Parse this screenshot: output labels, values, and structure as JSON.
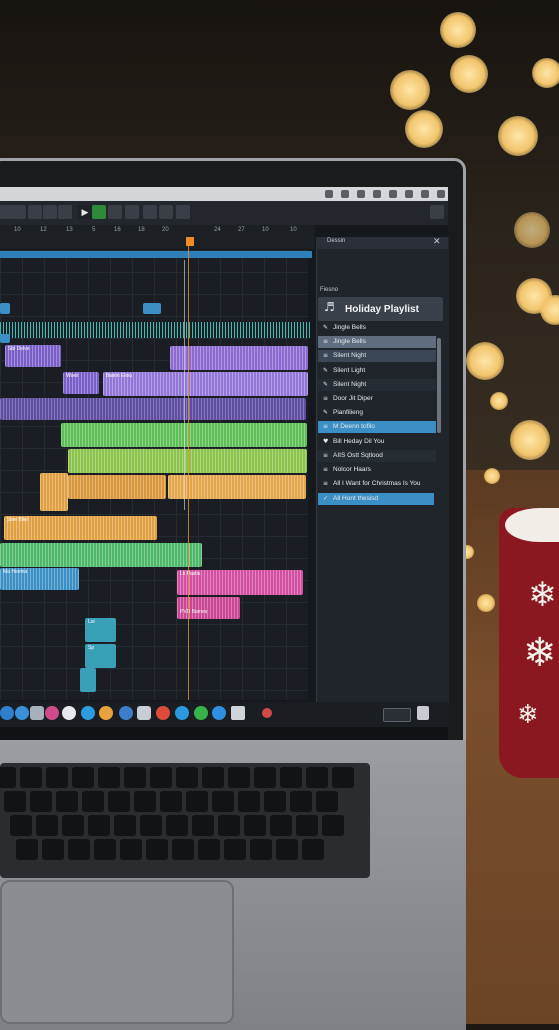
{
  "toolbar": {
    "play_icon": "▶"
  },
  "ruler": {
    "ticks": [
      "10",
      "12",
      "13",
      "5",
      "16",
      "18",
      "20",
      "24",
      "27",
      "10",
      "10"
    ]
  },
  "panel": {
    "header_label": "Dessin",
    "subheader": "Fiesno",
    "close_glyph": "✕",
    "title": "Holiday Playlist",
    "items": [
      {
        "label": "Jingle Bells",
        "icon": "pencil-icon",
        "selected": false
      },
      {
        "label": "Jingle Bells",
        "icon": "list-icon",
        "selected": "light"
      },
      {
        "label": "Silent Night",
        "icon": "list-icon",
        "selected": "dark"
      },
      {
        "label": "Silent Light",
        "icon": "pencil-icon",
        "selected": false
      },
      {
        "label": "Silent Night",
        "icon": "pencil-icon",
        "selected": false
      },
      {
        "label": "Door Jit Diper",
        "icon": "list-icon",
        "selected": false
      },
      {
        "label": "Pianfilieng",
        "icon": "pencil-icon",
        "selected": false
      },
      {
        "label": "M Deenn tofilo",
        "icon": "list-icon",
        "selected": "accent"
      },
      {
        "label": "Bill Heday Dil You",
        "icon": "heart-icon",
        "selected": false
      },
      {
        "label": "AIIS Ostt Sqtlood",
        "icon": "list-icon",
        "selected": false
      },
      {
        "label": "Nolcor Haars",
        "icon": "list-icon",
        "selected": false
      },
      {
        "label": "All I Want for Christmas Is You",
        "icon": "list-icon",
        "selected": false
      },
      {
        "label": "All Hont thesisd",
        "icon": "check-icon",
        "selected": "accent"
      }
    ]
  },
  "clips": {
    "purple_1": "Sbi Delve",
    "purple_2": "Woeii",
    "purple_3": "Bwirin Eloiu",
    "orange_1": "Stve Bllel",
    "blue_1": "Ma Heeina",
    "pink_1": "Lti Pastis",
    "pink_2": "PVD Bames",
    "cyan_1": "Loi",
    "cyan_2": "Sp"
  },
  "colors": {
    "accent": "#3b8fc4",
    "purple": "#7a5fc9",
    "green": "#5fbf57",
    "orange": "#e0a042",
    "pink": "#d24fa2",
    "teal": "#3fd0c4",
    "playhead": "#f08a24"
  }
}
